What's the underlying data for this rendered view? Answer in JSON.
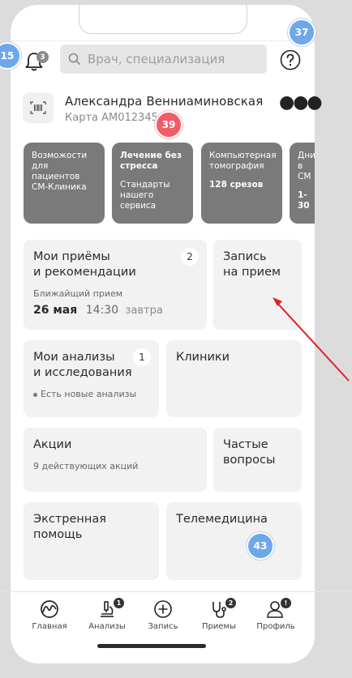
{
  "markers": {
    "m15": "15",
    "m37": "37",
    "m39": "39",
    "m43": "43"
  },
  "header": {
    "notifications_count": "3",
    "search_placeholder": "Врач, специализация"
  },
  "profile": {
    "name": "Александра Венниаминовская",
    "card": "Карта АМ012345"
  },
  "stories": [
    {
      "line1": "Возможости для пациентов СМ-Клиника",
      "line2": ""
    },
    {
      "line1": "Лечение без стресса",
      "line2": "Стандарты нашего сервиса"
    },
    {
      "line1": "Компьютерная томография",
      "line2": "128 срезов"
    },
    {
      "line1": "Дни в СМ",
      "line2": "1-30"
    }
  ],
  "tiles": {
    "appointments": {
      "title": "Мои приёмы\nи рекомендации",
      "count": "2",
      "note": "Ближайщий прием",
      "date": "26 мая",
      "time": "14:30",
      "day": "завтра"
    },
    "booking": {
      "title": "Запись\nна прием"
    },
    "analyses": {
      "title": "Мои анализы\nи исследования",
      "count": "1",
      "note": "Есть новые анализы"
    },
    "clinics": {
      "title": "Клиники"
    },
    "promos": {
      "title": "Акции",
      "note": "9 действующих акций"
    },
    "faq": {
      "title": "Частые\nвопросы"
    },
    "emergency": {
      "title": "Экстренная\nпомощь"
    },
    "telemed": {
      "title": "Телемедицина"
    }
  },
  "nav": {
    "home": "Главная",
    "analyses": "Анализы",
    "analyses_badge": "1",
    "booking": "Запись",
    "appointments": "Приемы",
    "appointments_badge": "2",
    "profile": "Профиль",
    "profile_badge": "!"
  },
  "colors": {
    "accent_marker": "#6fa8e8",
    "red_marker": "#ef5d68",
    "arrow": "#e0202a"
  }
}
